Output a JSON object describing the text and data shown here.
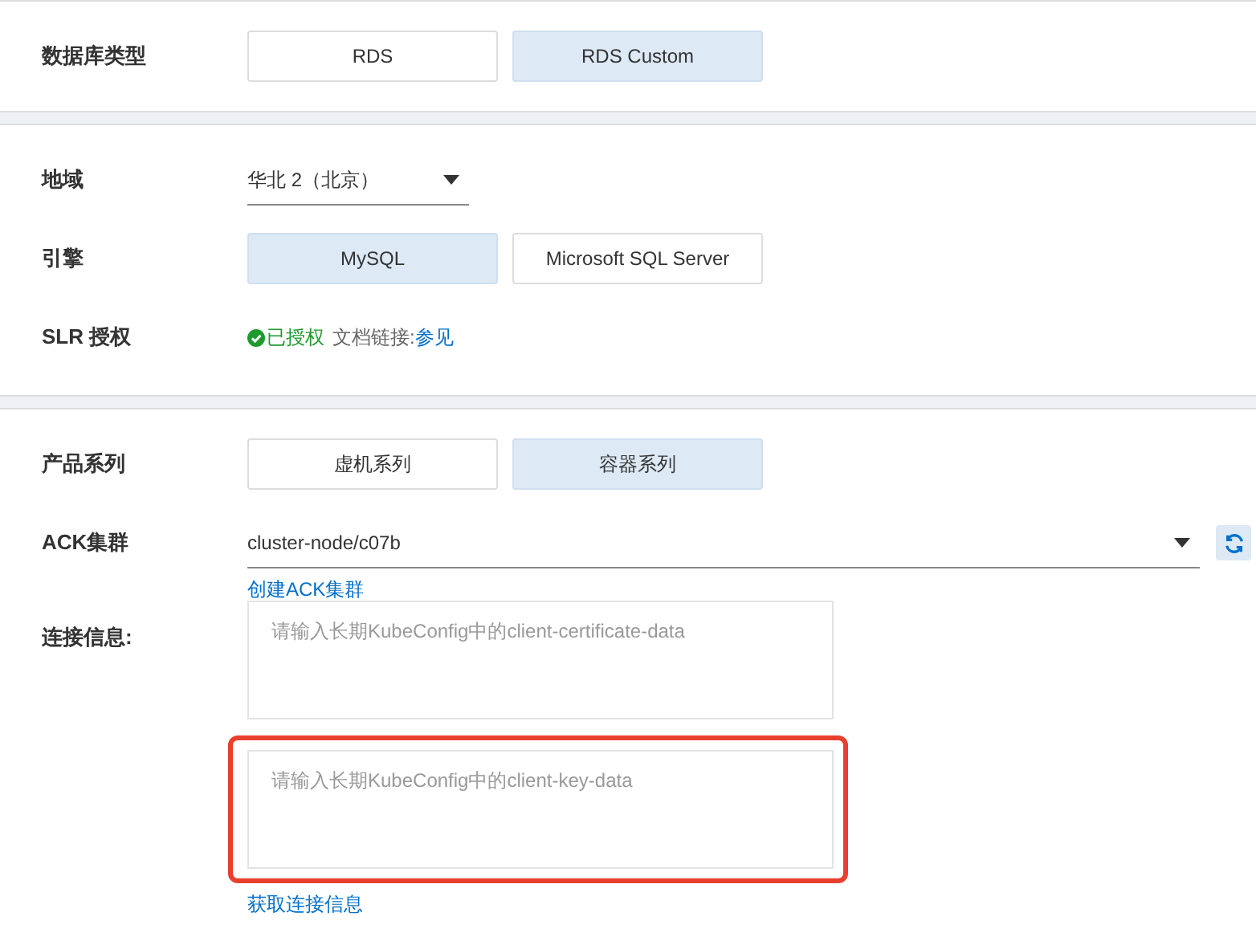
{
  "sections": [
    {
      "rows": [
        {
          "kind": "options",
          "label": "数据库类型",
          "options": [
            {
              "label": "RDS",
              "selected": false
            },
            {
              "label": "RDS Custom",
              "selected": true
            }
          ]
        }
      ]
    },
    {
      "rows": [
        {
          "kind": "select",
          "label": "地域",
          "value": "华北 2（北京）"
        },
        {
          "kind": "options",
          "label": "引擎",
          "options": [
            {
              "label": "MySQL",
              "selected": true
            },
            {
              "label": "Microsoft SQL Server",
              "selected": false
            }
          ]
        },
        {
          "kind": "status",
          "label": "SLR 授权",
          "status": "已授权",
          "doc_text": "文档链接:",
          "doc_link": "参见"
        }
      ]
    },
    {
      "rows": [
        {
          "kind": "options",
          "label": "产品系列",
          "options": [
            {
              "label": "虚机系列",
              "selected": false
            },
            {
              "label": "容器系列",
              "selected": true
            }
          ]
        },
        {
          "kind": "cluster",
          "label": "ACK集群",
          "value": "cluster-node/c07b",
          "link": "创建ACK集群"
        },
        {
          "kind": "textareas",
          "label": "连接信息:",
          "fields": [
            {
              "placeholder": "请输入长期KubeConfig中的client-certificate-data",
              "highlighted": false
            },
            {
              "placeholder": "请输入长期KubeConfig中的client-key-data",
              "highlighted": true
            }
          ],
          "link": "获取连接信息"
        }
      ]
    }
  ]
}
